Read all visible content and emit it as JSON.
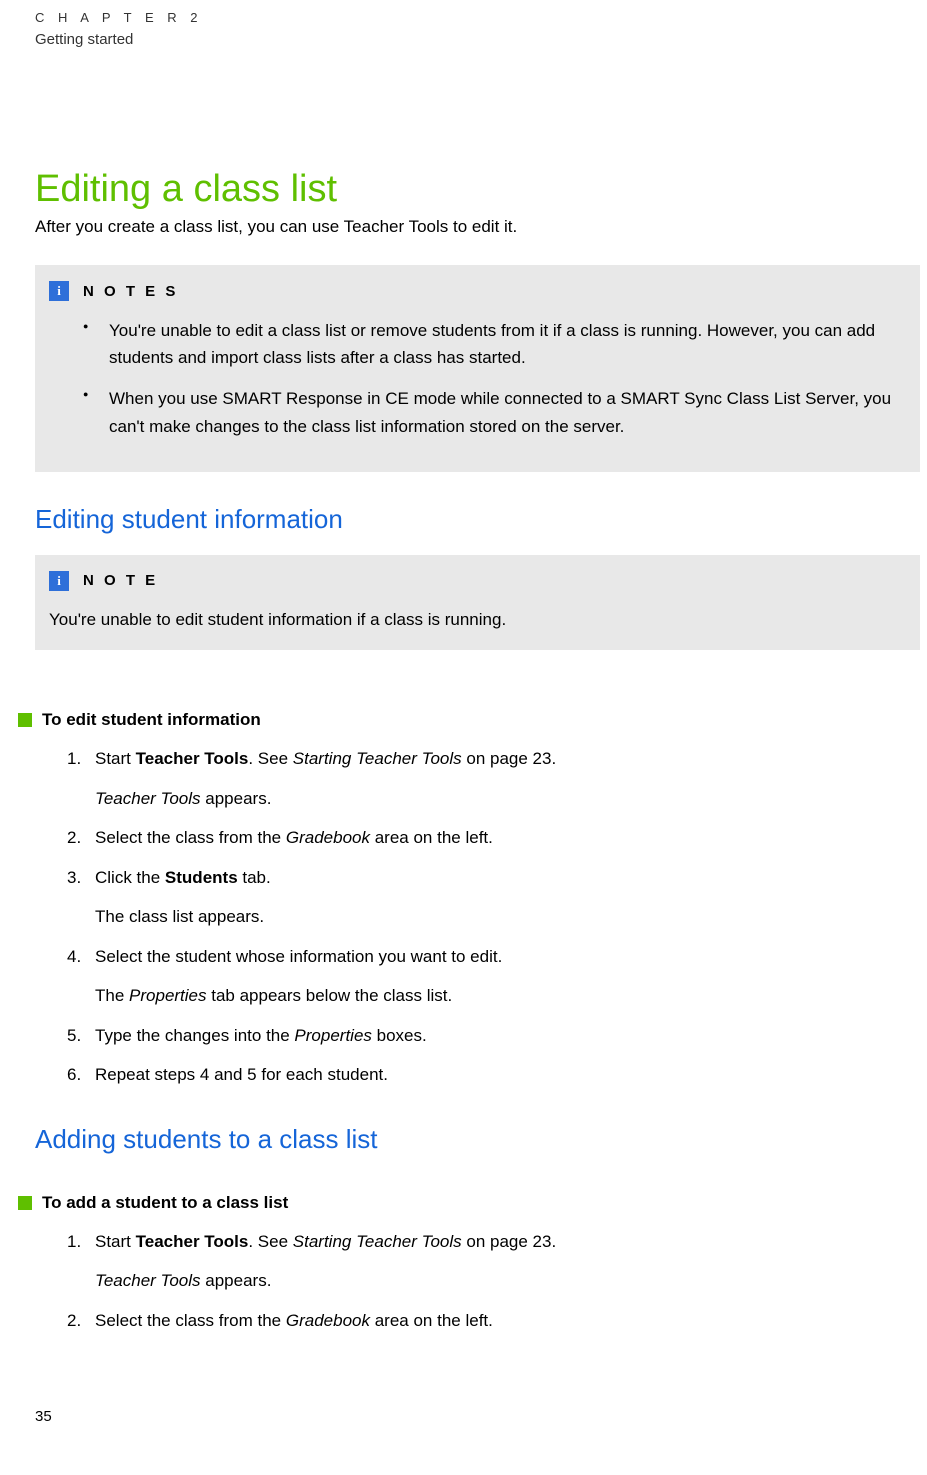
{
  "header": {
    "chapter_label": "C H A P T E R   2",
    "chapter_subtitle": "Getting started"
  },
  "main": {
    "h1": "Editing a class list",
    "intro": "After you create a class list, you can use Teacher Tools to edit it.",
    "notes_box": {
      "title": "N O T E S",
      "items": [
        "You're unable to edit a class list or remove students from it if a class is running. However, you can add students and import class lists after a class has started.",
        "When you use SMART Response in CE mode while connected to a SMART Sync Class List Server, you can't make changes to the class list information stored on the server."
      ]
    },
    "section1": {
      "h2": "Editing student information",
      "note_box": {
        "title": "N O T E",
        "text": "You're unable to edit student information if a class is running."
      },
      "proc_heading": "To edit student information",
      "steps": {
        "s1_num": "1.",
        "s1_a": "Start ",
        "s1_b": "Teacher Tools",
        "s1_c": ". See ",
        "s1_d": "Starting Teacher Tools",
        "s1_e": " on page 23.",
        "s1_result_a": "Teacher Tools",
        "s1_result_b": " appears.",
        "s2_num": "2.",
        "s2_a": "Select the class from the ",
        "s2_b": "Gradebook",
        "s2_c": " area on the left.",
        "s3_num": "3.",
        "s3_a": "Click the ",
        "s3_b": "Students",
        "s3_c": " tab.",
        "s3_result": "The class list appears.",
        "s4_num": "4.",
        "s4_a": "Select the student whose information you want to edit.",
        "s4_result_a": "The ",
        "s4_result_b": "Properties",
        "s4_result_c": " tab appears below the class list.",
        "s5_num": "5.",
        "s5_a": "Type the changes into the ",
        "s5_b": "Properties",
        "s5_c": " boxes.",
        "s6_num": "6.",
        "s6_a": "Repeat steps 4 and 5 for each student."
      }
    },
    "section2": {
      "h2": "Adding students to a class list",
      "proc_heading": "To add a student to a class list",
      "steps": {
        "s1_num": "1.",
        "s1_a": "Start ",
        "s1_b": "Teacher Tools",
        "s1_c": ". See ",
        "s1_d": "Starting Teacher Tools",
        "s1_e": " on page 23.",
        "s1_result_a": "Teacher Tools",
        "s1_result_b": " appears.",
        "s2_num": "2.",
        "s2_a": "Select the class from the ",
        "s2_b": "Gradebook",
        "s2_c": " area on the left."
      }
    }
  },
  "page_number": "35"
}
